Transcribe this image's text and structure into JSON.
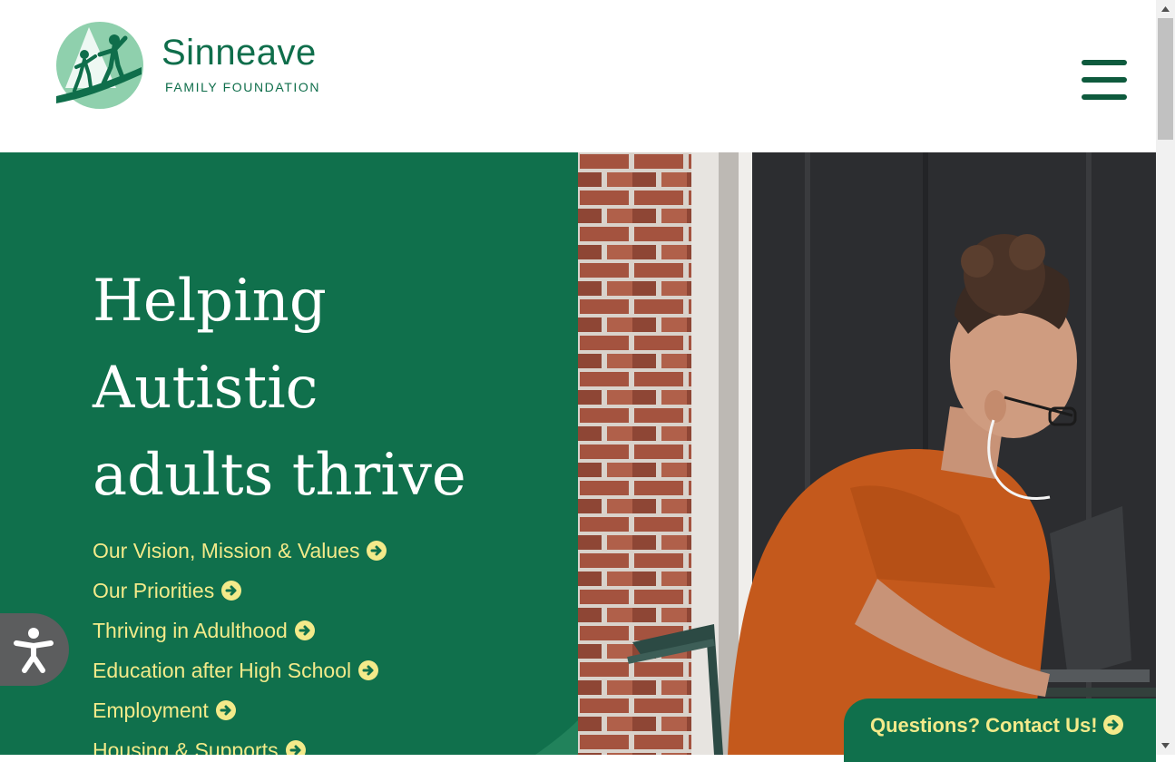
{
  "header": {
    "logo_name": "Sinneave",
    "logo_sub": "FAMILY FOUNDATION",
    "menu_icon": "hamburger-menu-icon"
  },
  "hero": {
    "headline_lines": [
      "Helping",
      "Autistic",
      "adults thrive"
    ],
    "links": [
      "Our Vision, Mission & Values",
      "Our Priorities",
      "Thriving in Adulthood",
      "Education after High School",
      "Employment",
      "Housing & Supports"
    ],
    "link_icon": "arrow-circle-right-icon"
  },
  "accessibility": {
    "icon": "accessibility-person-icon"
  },
  "contact": {
    "label": "Questions? Contact Us!",
    "icon": "arrow-circle-right-icon"
  },
  "colors": {
    "brand_green": "#10704c",
    "dark_green": "#0e5a3d",
    "accent_yellow": "#f3ea8a",
    "light_green": "#8fd0ad"
  }
}
